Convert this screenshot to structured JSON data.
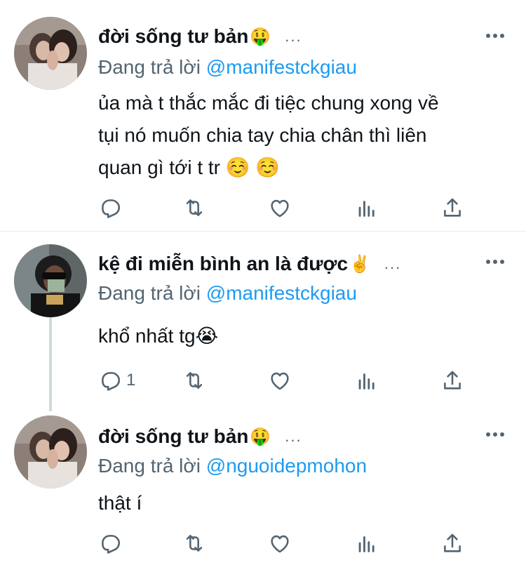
{
  "tweets": [
    {
      "display_name": "đời sống tư bản",
      "name_emoji": "🤑",
      "name_dots": "...",
      "reply_prefix": "Đang trả lời",
      "reply_handle": "@manifestckgiau",
      "body_lines": [
        "ủa mà t thắc mắc đi tiệc chung xong về",
        "tụi nó muốn chia tay chia chân thì liên",
        "quan gì tới t tr ☺️ ☺️"
      ],
      "reply_count": ""
    },
    {
      "display_name": "kệ đi miễn bình an là được",
      "name_emoji": "✌️",
      "name_dots": "...",
      "reply_prefix": "Đang trả lời",
      "reply_handle": "@manifestckgiau",
      "body_lines": [
        "khổ nhất tg😭"
      ],
      "reply_count": "1"
    },
    {
      "display_name": "đời sống tư bản",
      "name_emoji": "🤑",
      "name_dots": "...",
      "reply_prefix": "Đang trả lời",
      "reply_handle": "@nguoidepmohon",
      "body_lines": [
        "thật í"
      ],
      "reply_count": ""
    }
  ],
  "icons": {
    "reply": "reply-icon",
    "retweet": "retweet-icon",
    "like": "heart-icon",
    "analytics": "analytics-icon",
    "share": "share-icon",
    "more": "more-icon"
  },
  "colors": {
    "link": "#1d9bf0",
    "secondary": "#536471",
    "divider": "#e6ecf0"
  }
}
